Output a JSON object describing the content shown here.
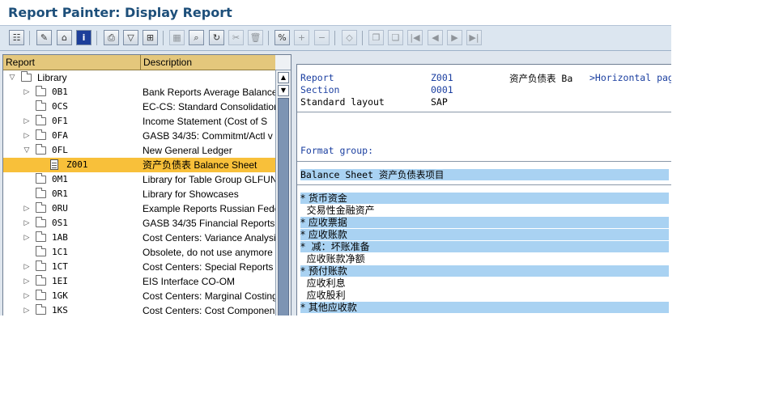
{
  "window": {
    "title": "Report Painter: Display Report"
  },
  "tree": {
    "columns": [
      "Report",
      "Description"
    ],
    "rows": [
      {
        "arrow": "▽",
        "icon": "folder",
        "code": "Library",
        "desc": "",
        "indent": 0,
        "selected": false
      },
      {
        "arrow": "▷",
        "icon": "folder",
        "code": "0B1",
        "desc": "Bank Reports Average Balance",
        "indent": 1,
        "selected": false
      },
      {
        "arrow": "",
        "icon": "folder",
        "code": "0CS",
        "desc": "EC-CS: Standard Consolidation",
        "indent": 1,
        "selected": false
      },
      {
        "arrow": "▷",
        "icon": "folder",
        "code": "0F1",
        "desc": "Income Statement (Cost of S",
        "indent": 1,
        "selected": false
      },
      {
        "arrow": "▷",
        "icon": "folder",
        "code": "0FA",
        "desc": "GASB 34/35: Commitmt/Actl v",
        "indent": 1,
        "selected": false
      },
      {
        "arrow": "▽",
        "icon": "folder-open",
        "code": "0FL",
        "desc": "New General Ledger",
        "indent": 1,
        "selected": false
      },
      {
        "arrow": "",
        "icon": "document",
        "code": "Z001",
        "desc": "资产负债表 Balance Sheet",
        "indent": 2,
        "selected": true
      },
      {
        "arrow": "",
        "icon": "folder",
        "code": "0M1",
        "desc": "Library for Table Group GLFUN",
        "indent": 1,
        "selected": false
      },
      {
        "arrow": "",
        "icon": "folder",
        "code": "0R1",
        "desc": "Library for Showcases",
        "indent": 1,
        "selected": false
      },
      {
        "arrow": "▷",
        "icon": "folder",
        "code": "0RU",
        "desc": "Example Reports Russian Fede",
        "indent": 1,
        "selected": false
      },
      {
        "arrow": "▷",
        "icon": "folder",
        "code": "0S1",
        "desc": "GASB 34/35 Financial Reports",
        "indent": 1,
        "selected": false
      },
      {
        "arrow": "▷",
        "icon": "folder",
        "code": "1AB",
        "desc": "Cost Centers: Variance Analysi",
        "indent": 1,
        "selected": false
      },
      {
        "arrow": "",
        "icon": "folder",
        "code": "1C1",
        "desc": "Obsolete, do not use anymore",
        "indent": 1,
        "selected": false
      },
      {
        "arrow": "▷",
        "icon": "folder",
        "code": "1CT",
        "desc": "Cost Centers: Special Reports",
        "indent": 1,
        "selected": false
      },
      {
        "arrow": "▷",
        "icon": "folder",
        "code": "1EI",
        "desc": "EIS Interface CO-OM",
        "indent": 1,
        "selected": false
      },
      {
        "arrow": "▷",
        "icon": "folder",
        "code": "1GK",
        "desc": "Cost Centers: Marginal Costing",
        "indent": 1,
        "selected": false
      },
      {
        "arrow": "▷",
        "icon": "folder",
        "code": "1KS",
        "desc": "Cost Centers: Cost Componen",
        "indent": 1,
        "selected": false
      }
    ]
  },
  "detail": {
    "report_label": "Report",
    "report_value": "Z001",
    "report_desc": "资产负债表 Ba",
    "report_suffix": ">Horizontal page",
    "section_label": "Section",
    "section_value": "0001",
    "layout_label": "Standard layout",
    "layout_value": "SAP",
    "format_group_label": "Format group:",
    "balance_sheet_line": "Balance Sheet 资产负债表项目",
    "items": [
      {
        "text": "* 货币资金",
        "highlight": true
      },
      {
        "text": "  交易性金融资产",
        "highlight": false
      },
      {
        "text": "* 应收票据",
        "highlight": true
      },
      {
        "text": "* 应收账款",
        "highlight": true
      },
      {
        "text": "*  减：坏账准备",
        "highlight": true
      },
      {
        "text": "  应收账款净额",
        "highlight": false
      },
      {
        "text": "* 预付账款",
        "highlight": true
      },
      {
        "text": "  应收利息",
        "highlight": false
      },
      {
        "text": "  应收股利",
        "highlight": false
      },
      {
        "text": "* 其他应收款",
        "highlight": true
      },
      {
        "text": "",
        "highlight": false
      }
    ]
  },
  "toolbar": {
    "icons": [
      "hierarchy-icon",
      "edit-pencil-icon",
      "structure-icon",
      "info-icon",
      "print-icon",
      "filter-icon",
      "tree-icon",
      "spreadsheet-icon",
      "search-icon",
      "refresh-icon",
      "scissors-icon",
      "trash-icon",
      "variable-icon",
      "add-row-icon",
      "remove-row-icon",
      "eraser-icon",
      "copy-icon",
      "paste-icon",
      "first-page-icon",
      "previous-page-icon",
      "next-page-icon",
      "last-page-icon"
    ]
  }
}
